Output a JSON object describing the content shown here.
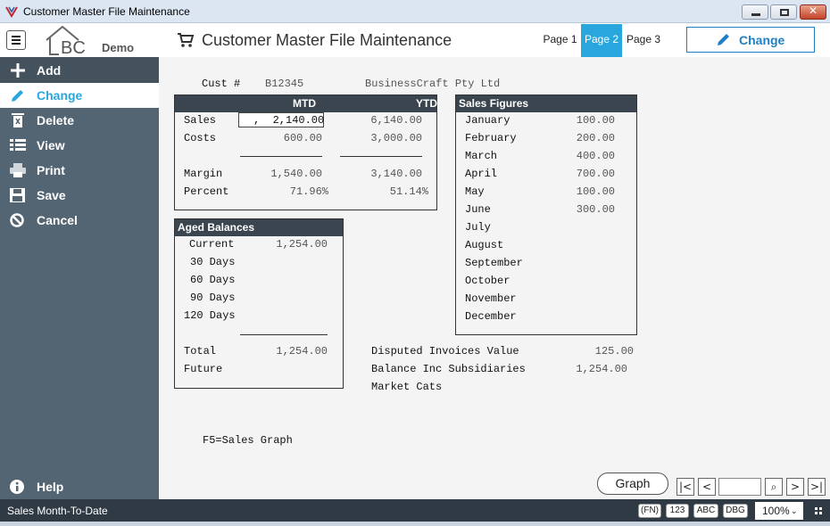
{
  "window": {
    "title": "Customer Master File Maintenance"
  },
  "header": {
    "logo_text": "BC",
    "logo_demo": "Demo",
    "title": "Customer Master File Maintenance",
    "tabs": [
      {
        "label": "Page 1"
      },
      {
        "label": "Page 2"
      },
      {
        "label": "Page 3"
      }
    ],
    "active_tab": "Page 2",
    "action_label": "Change"
  },
  "sidebar": {
    "items": [
      {
        "label": "Add",
        "icon": "plus-icon"
      },
      {
        "label": "Change",
        "icon": "pencil-icon"
      },
      {
        "label": "Delete",
        "icon": "trash-icon"
      },
      {
        "label": "View",
        "icon": "list-icon"
      },
      {
        "label": "Print",
        "icon": "printer-icon"
      },
      {
        "label": "Save",
        "icon": "floppy-icon"
      },
      {
        "label": "Cancel",
        "icon": "cancel-icon"
      }
    ],
    "active": "Change",
    "help_label": "Help"
  },
  "customer": {
    "label": "Cust #",
    "code": "B12345",
    "name": "BusinessCraft Pty Ltd"
  },
  "mtd_ytd": {
    "col_mtd": "MTD",
    "col_ytd": "YTD",
    "rows": [
      {
        "label": "Sales",
        "mtd": ",  2,140.00",
        "ytd": "6,140.00"
      },
      {
        "label": "Costs",
        "mtd": "600.00",
        "ytd": "3,000.00"
      },
      {
        "label": "Margin",
        "mtd": "1,540.00",
        "ytd": "3,140.00"
      },
      {
        "label": "Percent",
        "mtd": "71.96%",
        "ytd": "51.14%"
      }
    ]
  },
  "sales_figures": {
    "title": "Sales Figures",
    "months": [
      {
        "month": "January",
        "value": "100.00"
      },
      {
        "month": "February",
        "value": "200.00"
      },
      {
        "month": "March",
        "value": "400.00"
      },
      {
        "month": "April",
        "value": "700.00"
      },
      {
        "month": "May",
        "value": "100.00"
      },
      {
        "month": "June",
        "value": "300.00"
      },
      {
        "month": "July",
        "value": ""
      },
      {
        "month": "August",
        "value": ""
      },
      {
        "month": "September",
        "value": ""
      },
      {
        "month": "October",
        "value": ""
      },
      {
        "month": "November",
        "value": ""
      },
      {
        "month": "December",
        "value": ""
      }
    ]
  },
  "aged_balances": {
    "title": "Aged Balances",
    "rows": [
      {
        "label": "Current",
        "value": "1,254.00"
      },
      {
        "label": "30 Days",
        "value": ""
      },
      {
        "label": "60 Days",
        "value": ""
      },
      {
        "label": "90 Days",
        "value": ""
      },
      {
        "label": "120 Days",
        "value": ""
      }
    ],
    "total_label": "Total",
    "total_value": "1,254.00",
    "future_label": "Future"
  },
  "extra": {
    "disputed_label": "Disputed Invoices Value",
    "disputed_value": "125.00",
    "balance_label": "Balance Inc Subsidiaries",
    "balance_value": "1,254.00",
    "market_label": "Market Cats"
  },
  "hint": "F5=Sales Graph",
  "graph_button": "Graph",
  "nav": {
    "first": "|<",
    "prev": "<",
    "search": "⌕",
    "next": ">",
    "last": ">|"
  },
  "status": {
    "text": "Sales Month-To-Date",
    "chips": [
      "(FN)",
      "123",
      "ABC",
      "DBG"
    ],
    "zoom": "100%"
  },
  "colors": {
    "accent": "#2aa6df",
    "sidebar": "#536472",
    "panel_header": "#3b454f"
  }
}
